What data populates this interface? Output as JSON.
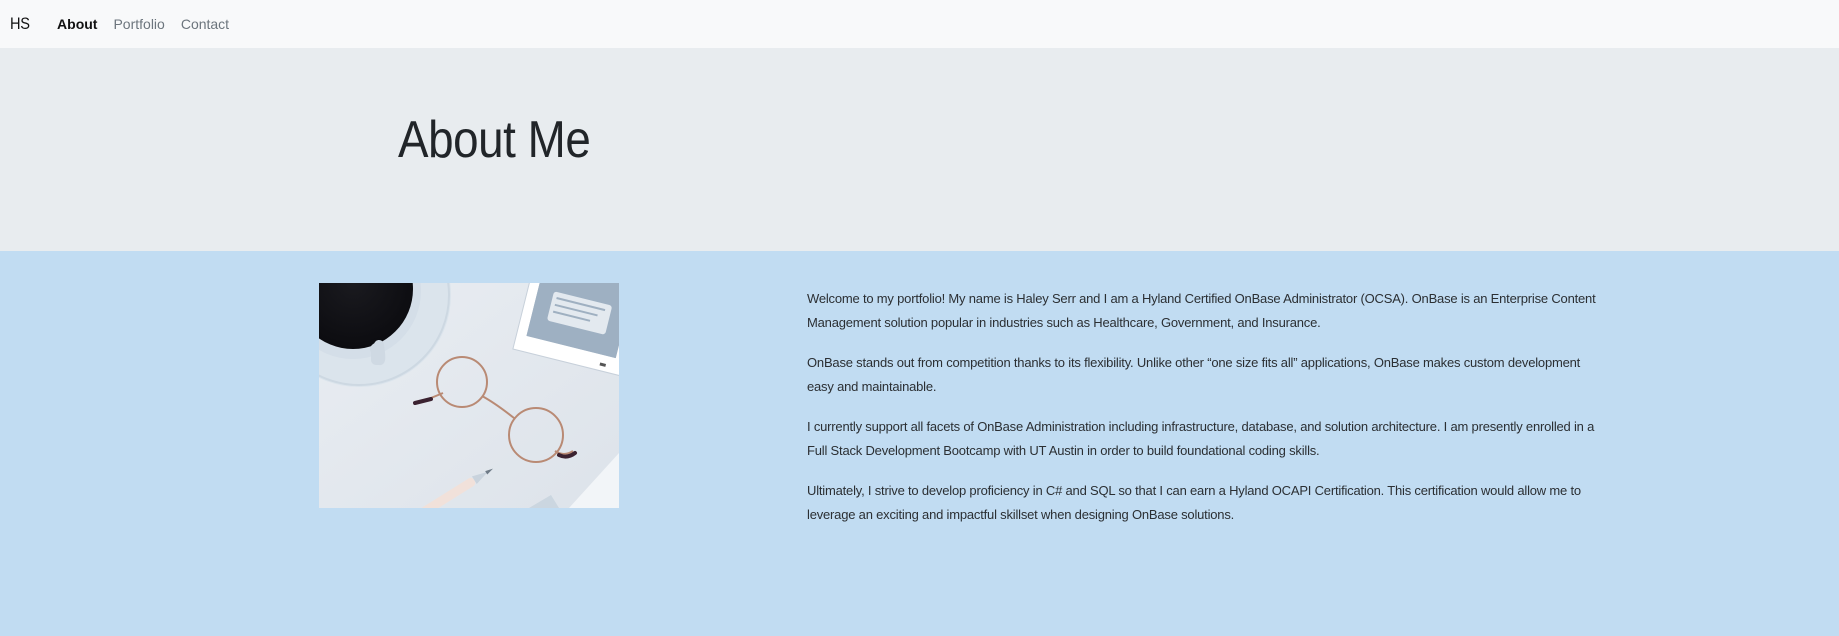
{
  "navbar": {
    "brand": "HS",
    "links": [
      {
        "label": "About",
        "active": true
      },
      {
        "label": "Portfolio",
        "active": false
      },
      {
        "label": "Contact",
        "active": false
      }
    ]
  },
  "hero": {
    "title": "About Me"
  },
  "about": {
    "image": {
      "description_icon": "desk-photo-coffee-glasses-pen"
    },
    "paragraphs": [
      "Welcome to my portfolio! My name is Haley Serr and I am a Hyland Certified OnBase Administrator (OCSA). OnBase is an Enterprise Content Management solution popular in industries such as Healthcare, Government, and Insurance.",
      "OnBase stands out from competition thanks to its flexibility. Unlike other “one size fits all” applications, OnBase makes custom development easy and maintainable.",
      "I currently support all facets of OnBase Administration including infrastructure, database, and solution architecture. I am presently enrolled in a Full Stack Development Bootcamp with UT Austin in order to build foundational coding skills.",
      "Ultimately, I strive to develop proficiency in C# and SQL so that I can earn a Hyland OCAPI Certification. This certification would allow me to leverage an exciting and impactful skillset when designing OnBase solutions."
    ]
  },
  "colors": {
    "navbar_bg": "#f8f9fa",
    "hero_bg": "#e8ecef",
    "section_bg": "#c1dcf2",
    "text": "#212529",
    "muted_link": "#6c757d"
  }
}
